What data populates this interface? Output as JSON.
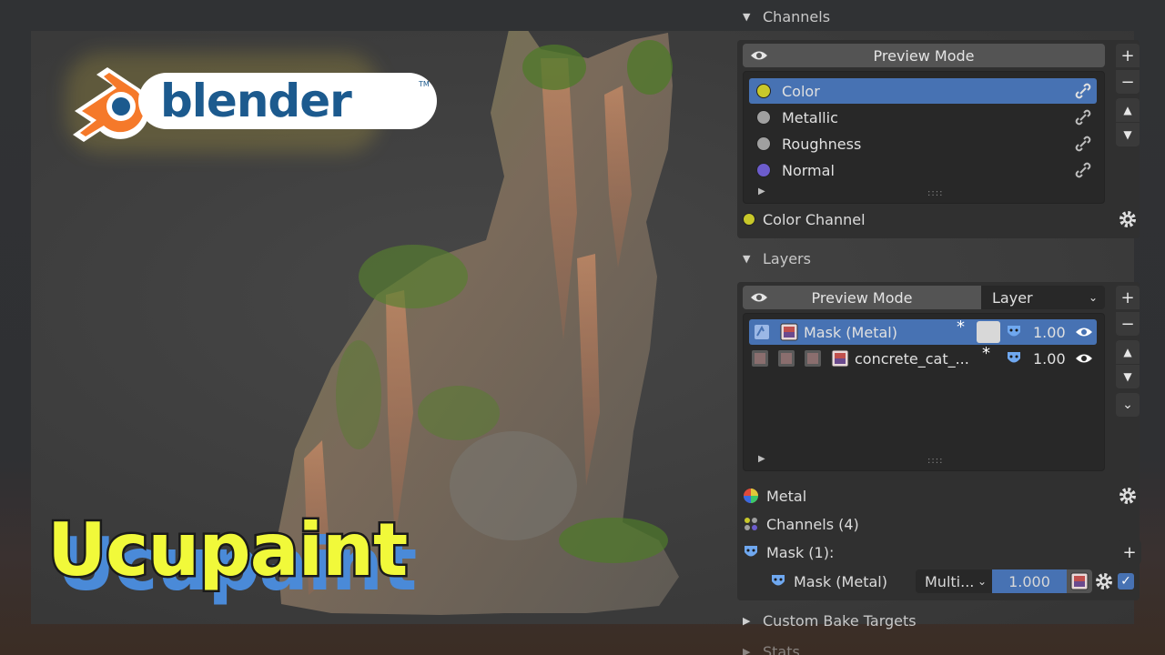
{
  "branding": {
    "logo_word": "blender",
    "logo_tm": "TM",
    "title": "Ucupaint"
  },
  "colors": {
    "selection": "#4772b3",
    "title_yellow": "#f1f93a",
    "logo_orange": "#f5792a",
    "logo_blue": "#1c5a8e",
    "channel_color": "#c8c82a",
    "channel_metallic": "#a0a0a0",
    "channel_roughness": "#a0a0a0",
    "channel_normal": "#6c5ccc"
  },
  "panel": {
    "channels": {
      "header": "Channels",
      "preview_mode": "Preview Mode",
      "items": [
        {
          "label": "Color",
          "dot": "#c8c82a",
          "selected": true
        },
        {
          "label": "Metallic",
          "dot": "#a0a0a0",
          "selected": false
        },
        {
          "label": "Roughness",
          "dot": "#a0a0a0",
          "selected": false
        },
        {
          "label": "Normal",
          "dot": "#6c5ccc",
          "selected": false
        }
      ],
      "active_channel": "Color Channel",
      "handle": "::::"
    },
    "layers": {
      "header": "Layers",
      "preview_mode": "Preview Mode",
      "mode_select": "Layer",
      "items": [
        {
          "label": "Mask (Metal)",
          "modified": "*",
          "value": "1.00",
          "selected": true
        },
        {
          "label": "concrete_cat_...",
          "modified": "*",
          "value": "1.00",
          "selected": false
        }
      ],
      "handle": "::::"
    },
    "props": {
      "metal": "Metal",
      "channels": "Channels (4)",
      "mask": "Mask (1):",
      "mask_item": "Mask (Metal)",
      "blend_mode": "Multi...",
      "mask_value": "1.000"
    },
    "collapsed": {
      "custom_bake": "Custom Bake Targets",
      "stats": "Stats"
    }
  }
}
